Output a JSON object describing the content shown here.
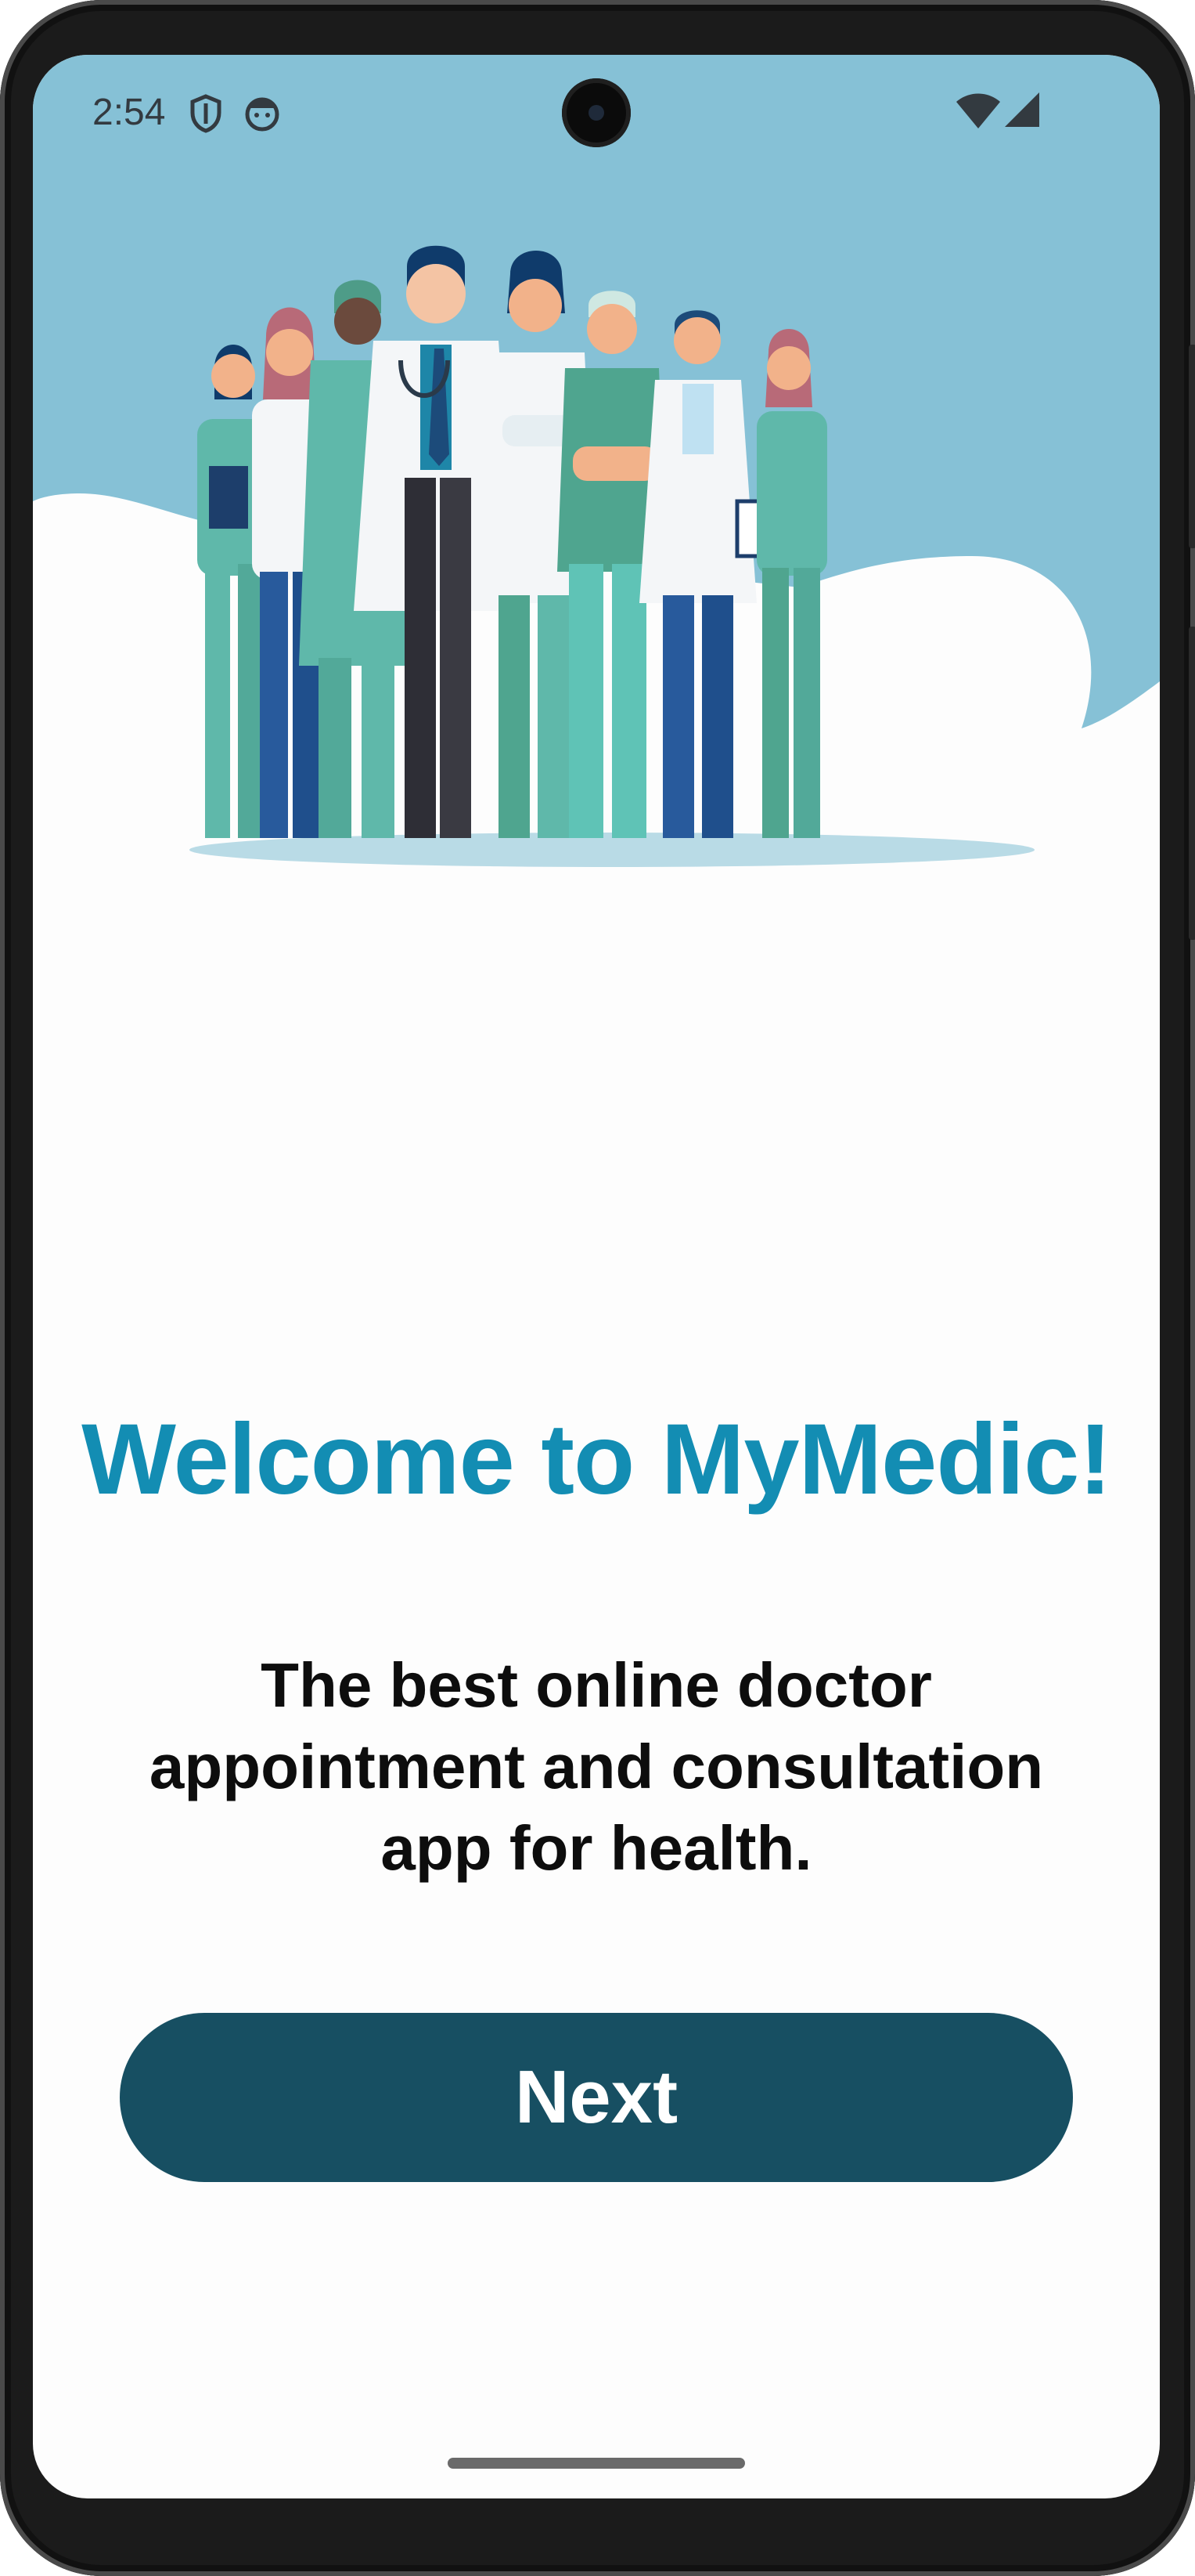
{
  "status_bar": {
    "time": "2:54",
    "icons": [
      "shield-icon",
      "face-icon",
      "wifi-icon",
      "signal-icon"
    ]
  },
  "hero": {
    "illustration": "doctors-group-illustration",
    "background_color": "#86c1d6"
  },
  "onboarding": {
    "title": "Welcome to MyMedic!",
    "subtitle": "The best online doctor appointment and consultation app for health.",
    "next_label": "Next"
  },
  "colors": {
    "title": "#138db3",
    "button": "#174f62",
    "button_text": "#ffffff"
  }
}
